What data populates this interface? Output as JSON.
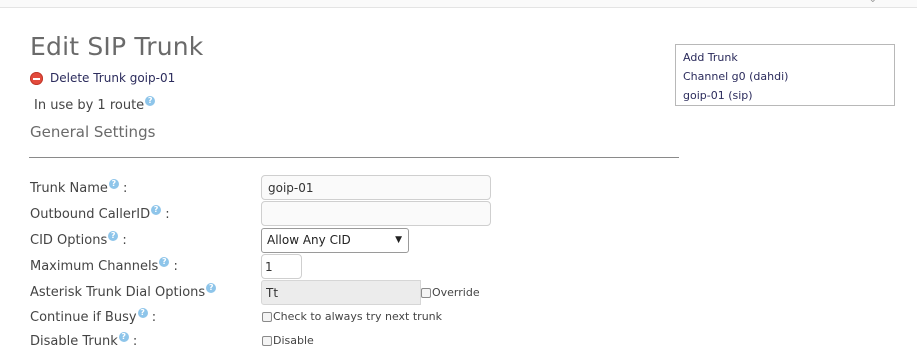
{
  "page": {
    "title": "Edit SIP Trunk"
  },
  "actions": {
    "delete_label": "Delete Trunk goip-01"
  },
  "usage": {
    "text": "In use by 1 route"
  },
  "section": {
    "title": "General Settings"
  },
  "side_panel": {
    "items": [
      "Add Trunk",
      "Channel g0 (dahdi)",
      "goip-01 (sip)"
    ]
  },
  "form": {
    "trunk_name": {
      "label": "Trunk Name",
      "suffix": ":",
      "value": "goip-01"
    },
    "outbound_cid": {
      "label": "Outbound CallerID",
      "suffix": ":",
      "value": ""
    },
    "cid_options": {
      "label": "CID Options",
      "suffix": ":",
      "selected": "Allow Any CID"
    },
    "max_channels": {
      "label": "Maximum Channels",
      "suffix": ":",
      "value": "1"
    },
    "dial_options": {
      "label": "Asterisk Trunk Dial Options",
      "value": "Tt",
      "override_label": "Override",
      "override_checked": false
    },
    "continue_busy": {
      "label": "Continue if Busy",
      "suffix": ":",
      "checkbox_label": "Check to always try next trunk",
      "checked": false
    },
    "disable_trunk": {
      "label": "Disable Trunk",
      "suffix": ":",
      "checkbox_label": "Disable",
      "checked": false
    }
  },
  "icons": {
    "help": "help-icon",
    "delete": "delete-icon",
    "dropdown": "chevron-down-icon"
  },
  "colors": {
    "help_icon": "#8ec5ea",
    "delete_icon": "#e34a3c",
    "link": "#2b2b5c"
  }
}
